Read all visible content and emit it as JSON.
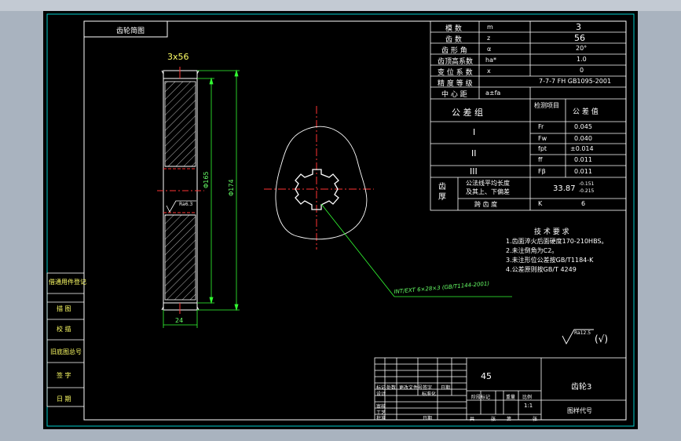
{
  "drawing": {
    "title_tab": "齿轮简图",
    "gear_label": "3x56",
    "dim_width": "24",
    "dim_root": "Φ165",
    "dim_tip": "Φ174",
    "roughness_left": "Ra6.3",
    "spline_callout": "INT/EXT 6×28×3 (GB/T1144-2001)",
    "roughness_note": "Ra12.5",
    "roughness_note_suffix": "(√)"
  },
  "params_table": {
    "rows": [
      {
        "name": "模 数",
        "symbol": "m",
        "value": "3"
      },
      {
        "name": "齿 数",
        "symbol": "z",
        "value": "56"
      },
      {
        "name": "齿 形 角",
        "symbol": "α",
        "value": "20°"
      },
      {
        "name": "齿顶高系数",
        "symbol": "ha*",
        "value": "1.0"
      },
      {
        "name": "变 位 系 数",
        "symbol": "x",
        "value": "0"
      },
      {
        "name": "精 度 等 级",
        "symbol": "",
        "value": "7-7-7 FH GB1095-2001"
      },
      {
        "name": "中 心 距",
        "symbol": "a±fa",
        "value": ""
      }
    ],
    "tol_header": {
      "group": "公 差 组",
      "item": "检测项目",
      "value": "公 差 值"
    },
    "tol_groups": [
      {
        "group": "I",
        "items": [
          {
            "sym": "Fr",
            "val": "0.045"
          },
          {
            "sym": "Fw",
            "val": "0.040"
          }
        ]
      },
      {
        "group": "II",
        "items": [
          {
            "sym": "fpt",
            "val": "±0.014"
          },
          {
            "sym": "ff",
            "val": "0.011"
          }
        ]
      },
      {
        "group": "III",
        "items": [
          {
            "sym": "Fβ",
            "val": "0.011"
          }
        ]
      }
    ],
    "thickness": {
      "label": "齿厚",
      "desc_line1": "公法线平均长度",
      "desc_line2": "及其上、下偏差",
      "value": "33.87",
      "upper": "-0.151",
      "lower": "-0.215",
      "span_label": "跨 齿 度",
      "span_sym": "K",
      "span_val": "6"
    }
  },
  "notes": {
    "title": "技 术 要 求",
    "items": [
      "1.齿面淬火后面硬度170-210HBS。",
      "2.未注倒角为C2。",
      "3.未注形位公差按GB/T1184-K",
      "4.公差原则按GB/T 4249"
    ]
  },
  "left_stamp": [
    "借通用件登记",
    "描 图",
    "校 描",
    "旧底图总号",
    "签 字",
    "日 期"
  ],
  "title_block": {
    "material": "45",
    "part_name": "齿轮3",
    "drawing_no_label": "图样代号",
    "scale": "1:1",
    "row_labels": [
      "标记",
      "处数",
      "更改文件号",
      "签字",
      "日期"
    ],
    "design": "设计",
    "standard": "标准化",
    "check": "审核",
    "craft": "工艺",
    "approve": "批准",
    "stage": "阶段标记",
    "weight": "重量",
    "ratio": "比例",
    "total": "共",
    "sheet": "张",
    "page": "第",
    "date": "日期"
  }
}
